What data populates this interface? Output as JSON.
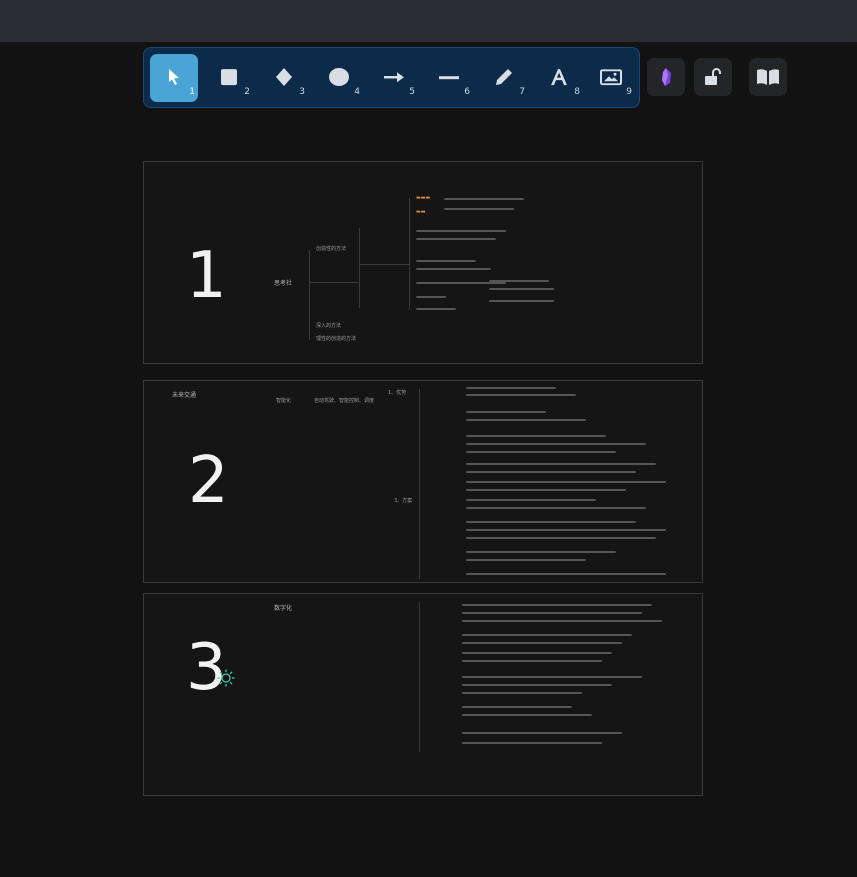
{
  "toolbar": {
    "tools": [
      {
        "name": "select",
        "num": "1",
        "icon": "cursor-icon"
      },
      {
        "name": "rectangle",
        "num": "2",
        "icon": "rectangle-icon"
      },
      {
        "name": "diamond",
        "num": "3",
        "icon": "diamond-icon"
      },
      {
        "name": "ellipse",
        "num": "4",
        "icon": "ellipse-icon"
      },
      {
        "name": "arrow",
        "num": "5",
        "icon": "arrow-icon"
      },
      {
        "name": "line",
        "num": "6",
        "icon": "line-icon"
      },
      {
        "name": "draw",
        "num": "7",
        "icon": "pencil-icon"
      },
      {
        "name": "text",
        "num": "8",
        "icon": "text-icon"
      },
      {
        "name": "image",
        "num": "9",
        "icon": "image-icon"
      }
    ],
    "extra": [
      {
        "name": "obsidian",
        "icon": "obsidian-gem-icon"
      },
      {
        "name": "lock",
        "icon": "unlock-icon"
      },
      {
        "name": "library",
        "icon": "book-icon"
      }
    ],
    "active_color": "#4aa5d6",
    "bar_color": "#0c2a4a"
  },
  "slides": [
    {
      "number": "1",
      "labels": {
        "root": "思考社",
        "b1": "创造性的方法",
        "b2": "深入的方法",
        "b3": "理性的创造的方法"
      }
    },
    {
      "number": "2",
      "labels": {
        "title": "未来交通",
        "n1": "智能化",
        "n2": "自动驾驶、智能控制、调度",
        "n3": "1、优势",
        "n4": "3、方案"
      }
    },
    {
      "number": "3",
      "labels": {
        "title": "数字化"
      },
      "icon": "sun-icon"
    }
  ]
}
